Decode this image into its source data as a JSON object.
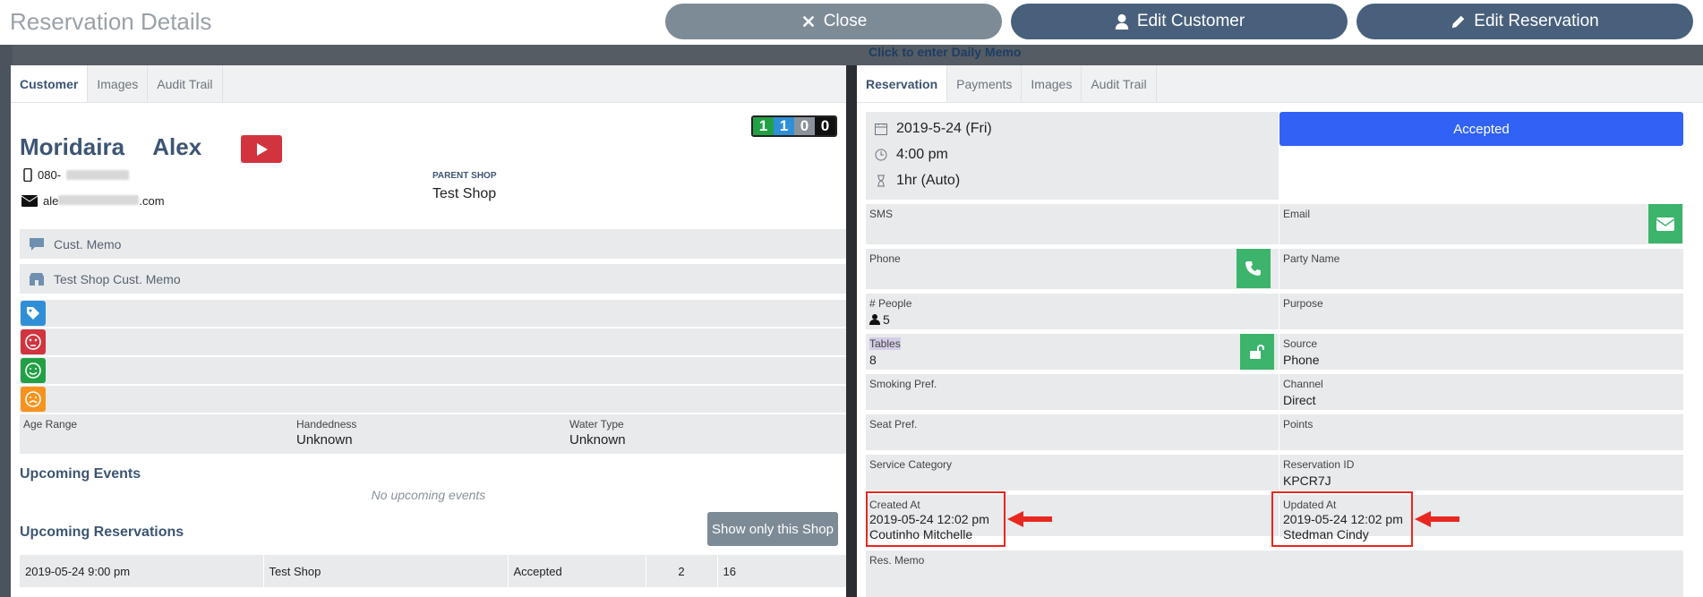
{
  "header": {
    "title": "Reservation Details",
    "close_label": "Close",
    "edit_customer_label": "Edit Customer",
    "edit_reservation_label": "Edit Reservation",
    "colors": {
      "close": "#7d8b97",
      "edit": "#48607c"
    }
  },
  "background": {
    "memo_link": "Click to enter Daily Memo"
  },
  "customer_panel": {
    "tabs": [
      "Customer",
      "Images",
      "Audit Trail"
    ],
    "last_name": "Moridaira",
    "first_name": "Alex",
    "phone_visible": "080-",
    "email_visible_start": "ale",
    "email_visible_end": ".com",
    "counters": [
      {
        "value": "1",
        "color": "#22a046"
      },
      {
        "value": "1",
        "color": "#2f8fd6"
      },
      {
        "value": "0",
        "color": "#8a939b"
      },
      {
        "value": "0",
        "color": "#111111"
      }
    ],
    "parent_shop_label": "PARENT SHOP",
    "parent_shop_value": "Test Shop",
    "cust_memo_label": "Cust. Memo",
    "shop_memo_label": "Test Shop Cust. Memo",
    "tag_icons": [
      {
        "icon": "tag-icon",
        "color": "#2f8fd6"
      },
      {
        "icon": "dizzy-face-icon",
        "color": "#d1343e"
      },
      {
        "icon": "smile-icon",
        "color": "#22a046"
      },
      {
        "icon": "frown-icon",
        "color": "#f7931e"
      }
    ],
    "attributes": [
      {
        "label": "Age Range",
        "value": ""
      },
      {
        "label": "Handedness",
        "value": "Unknown"
      },
      {
        "label": "Water Type",
        "value": "Unknown"
      }
    ],
    "upcoming_events_title": "Upcoming Events",
    "no_events_text": "No upcoming events",
    "upcoming_reservations_title": "Upcoming Reservations",
    "show_only_label": "Show only this Shop",
    "reservations": [
      {
        "datetime": "2019-05-24 9:00 pm",
        "shop": "Test Shop",
        "status": "Accepted",
        "party": "2",
        "table": "16"
      }
    ]
  },
  "reservation_panel": {
    "tabs": [
      "Reservation",
      "Payments",
      "Images",
      "Audit Trail"
    ],
    "date": "2019-5-24 (Fri)",
    "time": "4:00 pm",
    "duration": "1hr (Auto)",
    "status_label": "Accepted",
    "status_color": "#3162f5",
    "fields": {
      "sms": {
        "label": "SMS",
        "value": ""
      },
      "email": {
        "label": "Email",
        "value": ""
      },
      "phone": {
        "label": "Phone",
        "value": ""
      },
      "party_name": {
        "label": "Party Name",
        "value": ""
      },
      "people": {
        "label": "# People",
        "value": "5"
      },
      "purpose": {
        "label": "Purpose",
        "value": ""
      },
      "tables": {
        "label": "Tables",
        "value": "8"
      },
      "source": {
        "label": "Source",
        "value": "Phone"
      },
      "smoking": {
        "label": "Smoking Pref.",
        "value": ""
      },
      "channel": {
        "label": "Channel",
        "value": "Direct"
      },
      "seat": {
        "label": "Seat Pref.",
        "value": ""
      },
      "points": {
        "label": "Points",
        "value": ""
      },
      "service": {
        "label": "Service Category",
        "value": ""
      },
      "res_id": {
        "label": "Reservation ID",
        "value": "KPCR7J"
      },
      "created": {
        "label": "Created At",
        "value": "2019-05-24 12:02 pm",
        "by": "Coutinho Mitchelle"
      },
      "updated": {
        "label": "Updated At",
        "value": "2019-05-24 12:02 pm",
        "by": "Stedman Cindy"
      },
      "memo": {
        "label": "Res. Memo",
        "value": ""
      }
    }
  }
}
